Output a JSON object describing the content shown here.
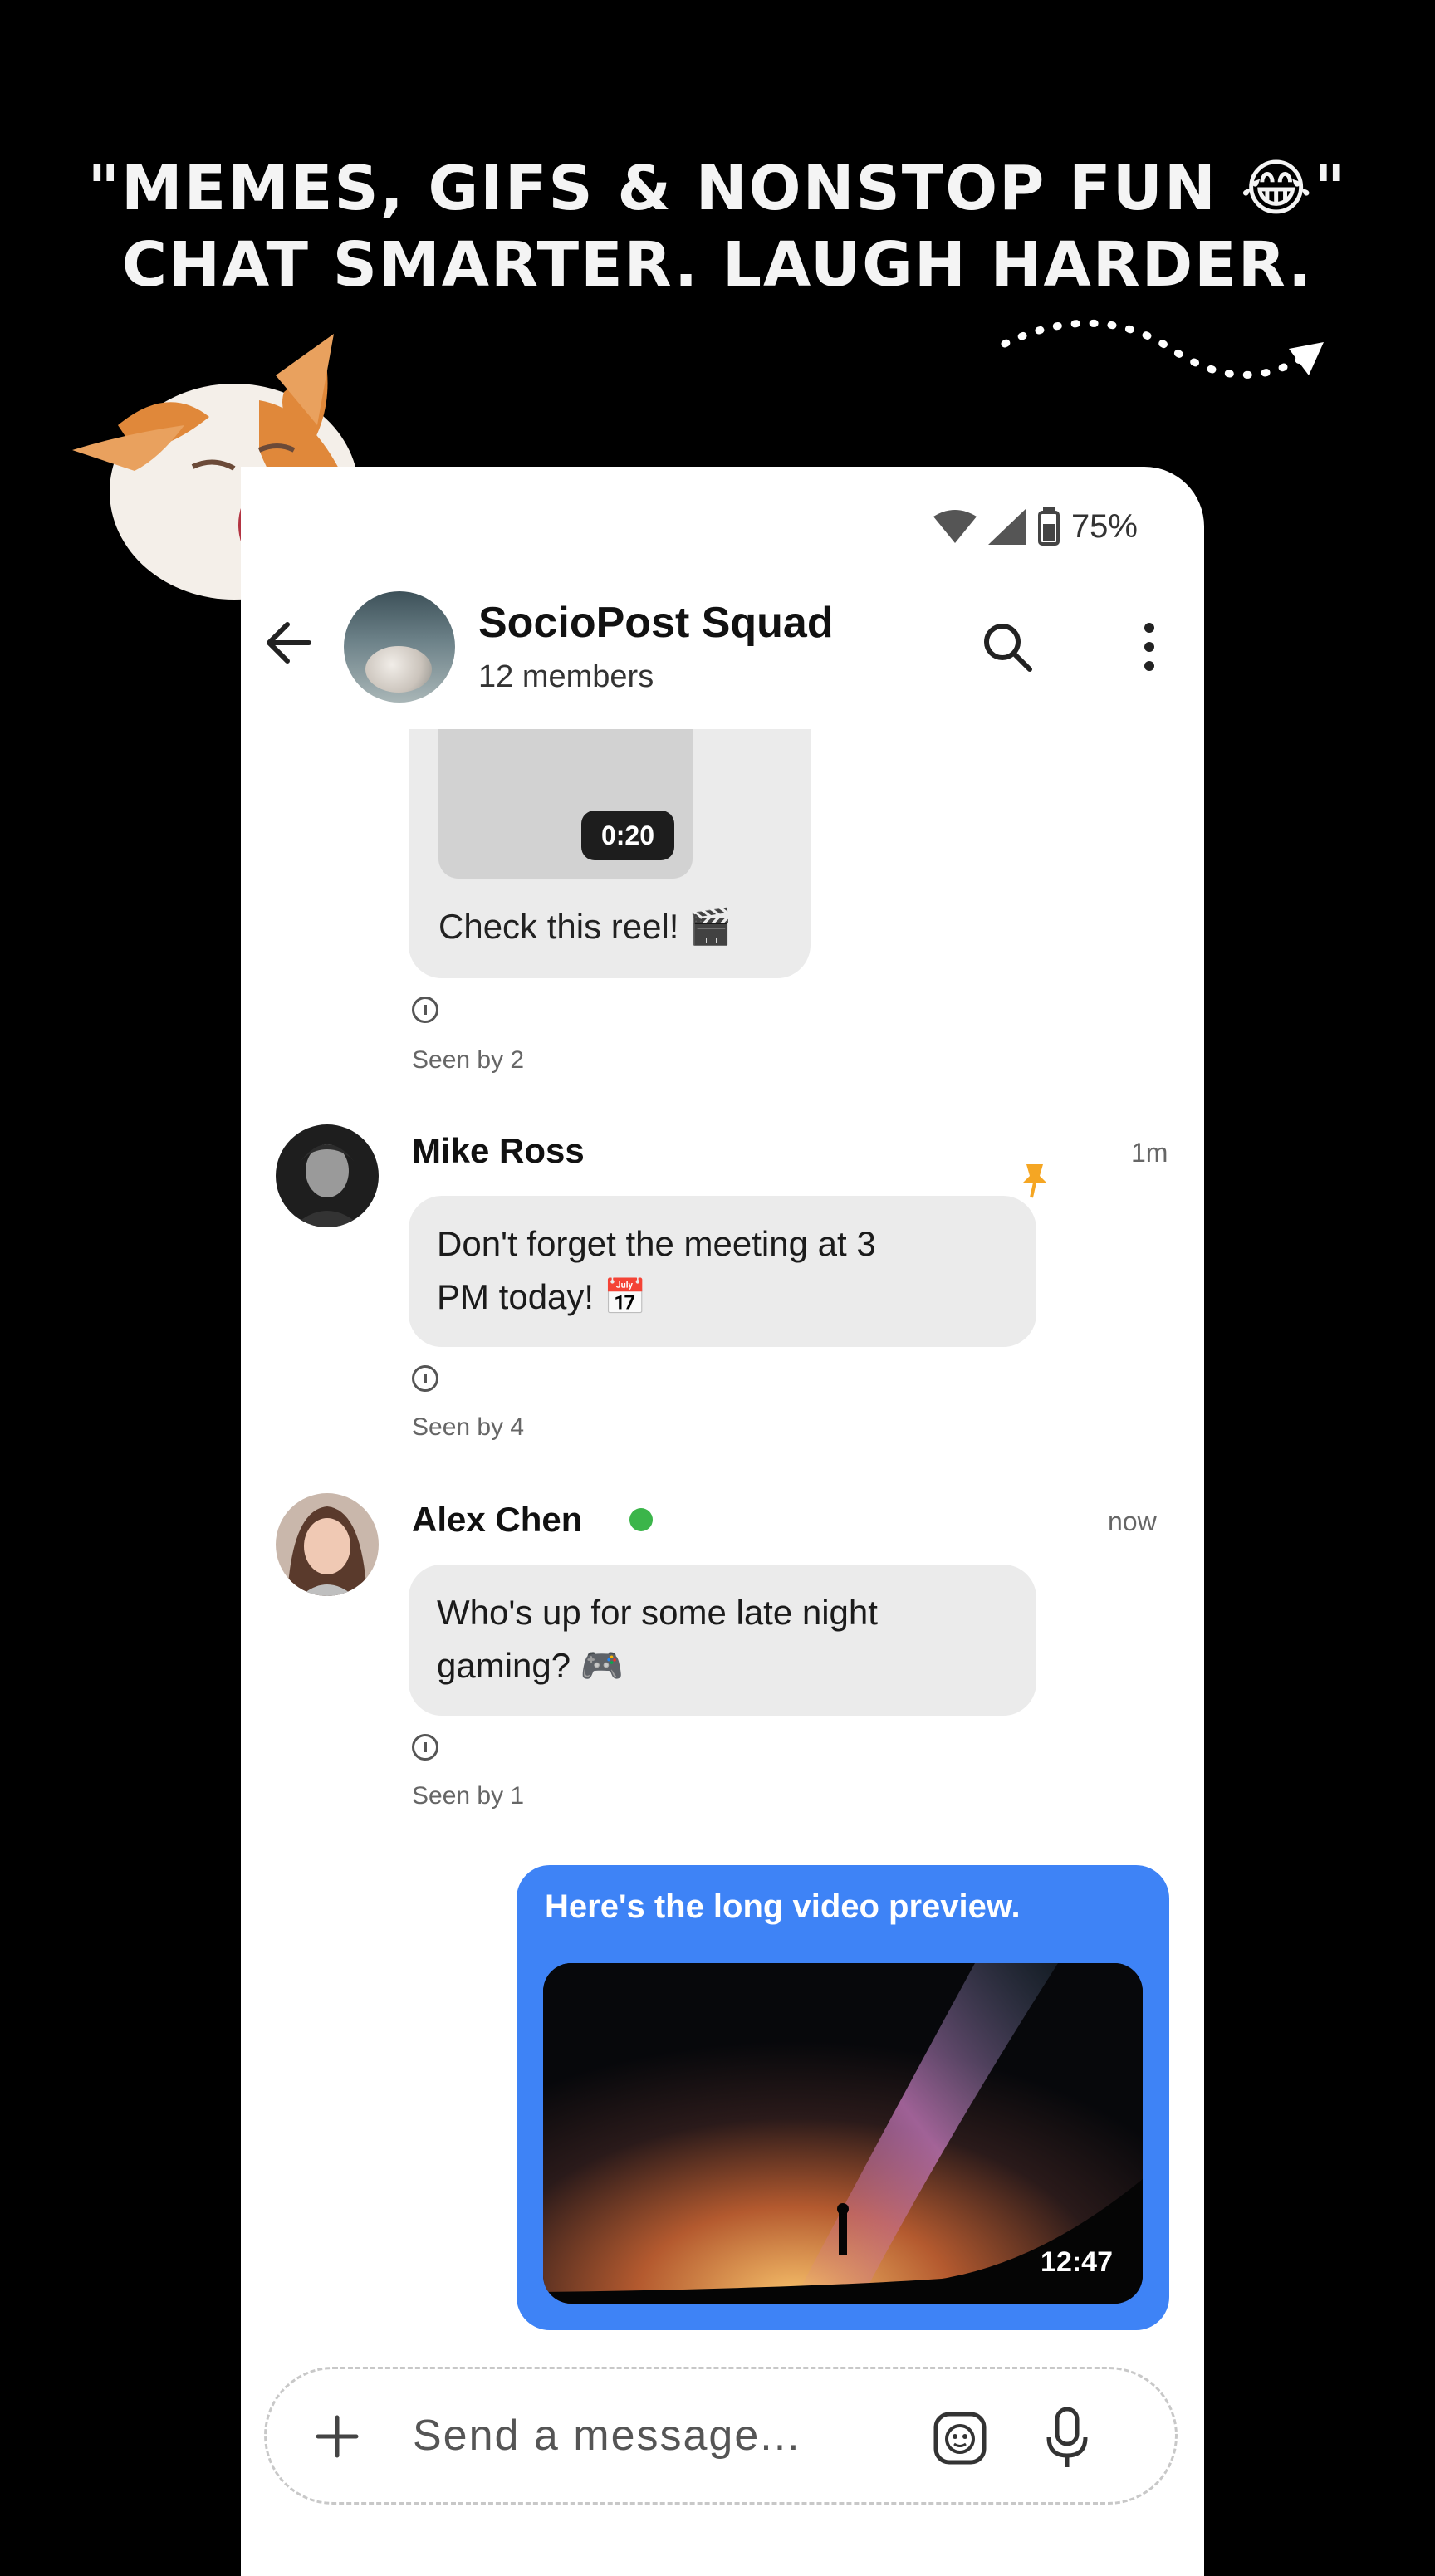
{
  "promo": {
    "headline_line1": "\"MEMES, GIFS & NONSTOP FUN 😂\"",
    "headline_line2": "CHAT SMARTER. LAUGH HARDER."
  },
  "status_bar": {
    "battery": "75%"
  },
  "app_bar": {
    "group_name": "SocioPost Squad",
    "member_count": "12 members"
  },
  "messages": [
    {
      "type": "video",
      "duration": "0:20",
      "caption": "Check this reel! 🎬",
      "seen": "Seen by 2"
    },
    {
      "sender": "Mike Ross",
      "time": "1m",
      "text_line1": "Don't forget the meeting at 3",
      "text_line2": "PM today! 📅",
      "pinned": true,
      "seen": "Seen by 4"
    },
    {
      "sender": "Alex Chen",
      "time": "now",
      "online": true,
      "text_line1": "Who's up for some late night",
      "text_line2": "gaming? 🎮",
      "seen": "Seen by 1"
    },
    {
      "type": "sent-video",
      "text": "Here's the long video preview.",
      "duration": "12:47"
    }
  ],
  "composer": {
    "placeholder": "Send a message..."
  },
  "colors": {
    "accent": "#3e83f6",
    "online": "#3bb54a",
    "pin": "#f5a623"
  }
}
